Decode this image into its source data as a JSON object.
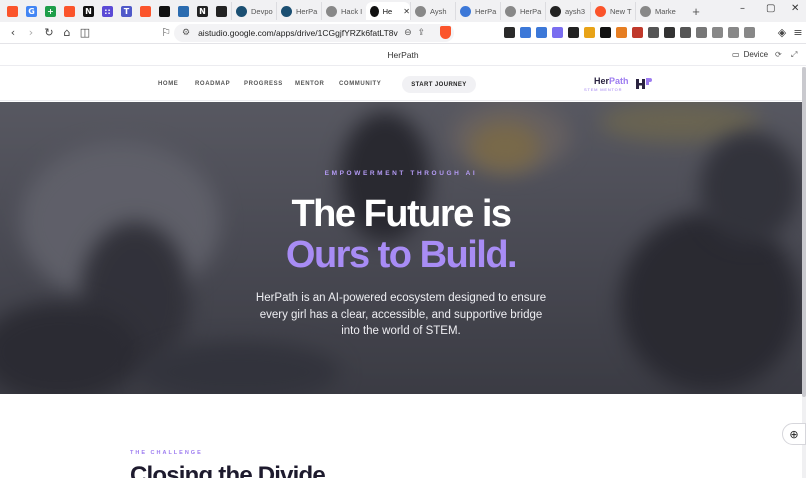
{
  "browser": {
    "tabs": [
      {
        "icon": "brave-icon",
        "color": "#fb542b",
        "glyph": "",
        "title": ""
      },
      {
        "icon": "google-icon",
        "color": "#4285f4",
        "glyph": "G",
        "title": ""
      },
      {
        "icon": "plus-app-icon",
        "color": "#1e9e4a",
        "glyph": "+",
        "title": ""
      },
      {
        "icon": "brave-icon",
        "color": "#fb542b",
        "glyph": "",
        "title": ""
      },
      {
        "icon": "n-app-icon",
        "color": "#111111",
        "glyph": "N",
        "title": ""
      },
      {
        "icon": "dots-app-icon",
        "color": "#5b4ad6",
        "glyph": "::",
        "title": ""
      },
      {
        "icon": "teams-icon",
        "color": "#5059c9",
        "glyph": "T",
        "title": ""
      },
      {
        "icon": "brave-icon",
        "color": "#fb542b",
        "glyph": "",
        "title": ""
      },
      {
        "icon": "black-app-icon",
        "color": "#111111",
        "glyph": "",
        "title": ""
      },
      {
        "icon": "chart-app-icon",
        "color": "#2b6cb0",
        "glyph": "",
        "title": ""
      },
      {
        "icon": "notion-icon",
        "color": "#222222",
        "glyph": "N",
        "title": ""
      },
      {
        "icon": "github-icon",
        "color": "#222222",
        "glyph": "",
        "title": ""
      }
    ],
    "titled_tabs": [
      {
        "icon": "devpost-icon",
        "color": "#1b4f72",
        "title": "Devpo",
        "active": false
      },
      {
        "icon": "globe-icon",
        "color": "#1b4f72",
        "title": "HerPa",
        "active": false
      },
      {
        "icon": "globe-icon",
        "color": "#888888",
        "title": "Hack I",
        "active": false
      },
      {
        "icon": "aistudio-icon",
        "color": "#111111",
        "title": "He",
        "active": true
      },
      {
        "icon": "globe-icon",
        "color": "#888888",
        "title": "Aysh",
        "active": false
      },
      {
        "icon": "globe-icon",
        "color": "#3c78d8",
        "title": "HerPa",
        "active": false
      },
      {
        "icon": "globe-icon",
        "color": "#888888",
        "title": "HerPa",
        "active": false
      },
      {
        "icon": "github-icon",
        "color": "#222222",
        "title": "aysh3",
        "active": false
      },
      {
        "icon": "brave-icon",
        "color": "#fb542b",
        "title": "New T",
        "active": false
      },
      {
        "icon": "globe-icon",
        "color": "#888888",
        "title": "Marke",
        "active": false
      }
    ],
    "url": "aistudio.google.com/apps/drive/1CGgjfYRZk6fatLT8v8dcP...",
    "extensions": [
      "#2a2a2a",
      "#3c78d8",
      "#3c78d8",
      "#7a6df0",
      "#222222",
      "#e8a317",
      "#111111",
      "#e67e22",
      "#c0392b",
      "#555555",
      "#333333",
      "#555555",
      "#777777",
      "#888888",
      "#888888",
      "#888888"
    ]
  },
  "app": {
    "title": "HerPath",
    "device_label": "Device"
  },
  "site": {
    "nav": {
      "home": "HOME",
      "roadmap": "ROADMAP",
      "progress": "PROGRESS",
      "mentor": "MENTOR",
      "community": "COMMUNITY",
      "cta": "START JOURNEY"
    },
    "logo": {
      "name_a": "Her",
      "name_b": "Path",
      "sub": "STEM MENTOR"
    },
    "hero": {
      "kicker": "EMPOWERMENT THROUGH AI",
      "line1": "The Future is",
      "line2": "Ours to Build.",
      "description": "HerPath is an AI-powered ecosystem designed to ensure every girl has a clear, accessible, and supportive bridge into the world of STEM."
    },
    "challenge": {
      "kicker": "THE CHALLENGE",
      "heading": "Closing the Divide"
    }
  },
  "colors": {
    "accent": "#9d7cf0",
    "hero_highlight": "#a88cf5",
    "dark": "#1e1b2e"
  }
}
